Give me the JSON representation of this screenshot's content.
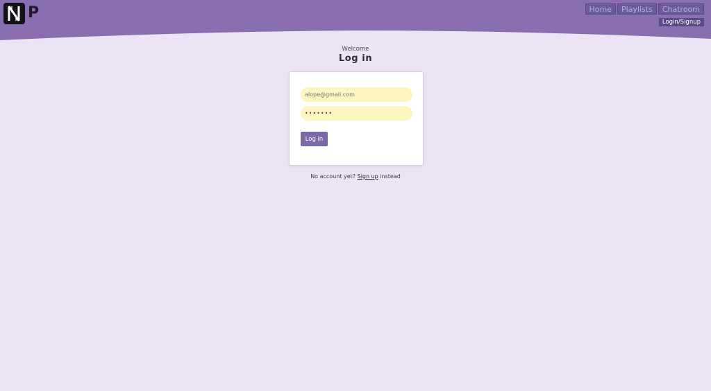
{
  "header": {
    "brand_letter": "P",
    "bg_color": "#8a6fb0",
    "nav": [
      {
        "label": "Home"
      },
      {
        "label": "Playlists"
      },
      {
        "label": "Chatroom"
      }
    ],
    "login_label": "Login/Signup"
  },
  "main": {
    "welcome": "Welcome",
    "title": "Log in",
    "email_placeholder": "alope@gmail.com",
    "password_value": "•••••••",
    "submit_label": "Log in",
    "signup_prefix": "No account yet? ",
    "signup_link": "Sign up",
    "signup_suffix": " instead"
  },
  "colors": {
    "page_bg": "#ece4f4",
    "accent": "#7a68a8",
    "field_bg": "#fdf6c0"
  },
  "icons": {
    "logo": "n-logo-icon"
  }
}
